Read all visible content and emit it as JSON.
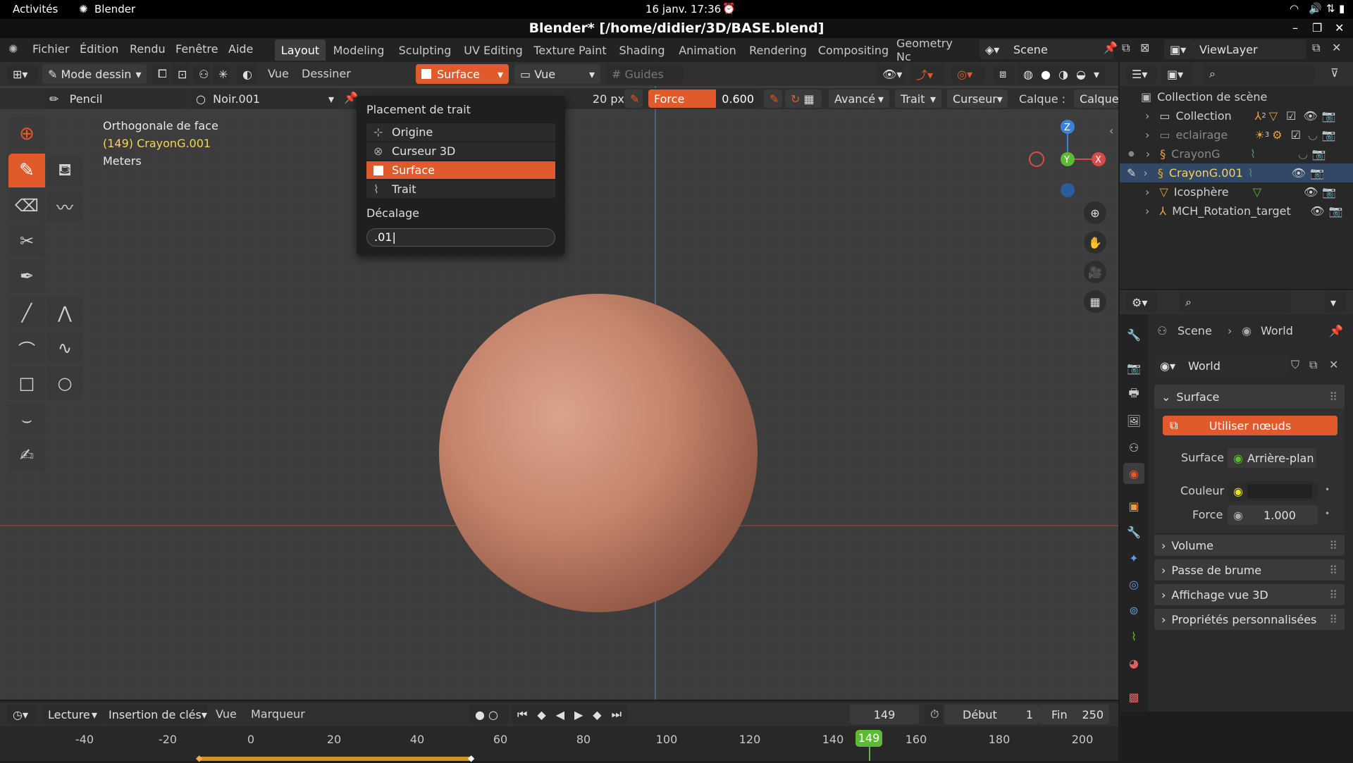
{
  "system": {
    "activities": "Activités",
    "app": "Blender",
    "clock": "16 janv.  17:36"
  },
  "window": {
    "title": "Blender* [/home/didier/3D/BASE.blend]"
  },
  "menu": [
    "Fichier",
    "Édition",
    "Rendu",
    "Fenêtre",
    "Aide"
  ],
  "workspaces": [
    "Layout",
    "Modeling",
    "Sculpting",
    "UV Editing",
    "Texture Paint",
    "Shading",
    "Animation",
    "Rendering",
    "Compositing",
    "Geometry Nc"
  ],
  "scene": "Scene",
  "viewlayer": "ViewLayer",
  "header": {
    "mode": "Mode dessin",
    "vue": "Vue",
    "dessiner": "Dessiner",
    "placement": "Surface",
    "orient": "Vue",
    "guides": "Guides"
  },
  "toolsettings": {
    "brush": "Pencil",
    "material": "Noir.001",
    "radius": "20 px",
    "force_label": "Force",
    "force_value": "0.600",
    "avance": "Avancé",
    "trait": "Trait",
    "curseur": "Curseur",
    "calque_label": "Calque :",
    "calque_value": "Calque"
  },
  "viewport": {
    "view_name": "Orthogonale de face",
    "object": "(149) CrayonG.001",
    "units": "Meters"
  },
  "popup": {
    "title": "Placement de trait",
    "items": [
      "Origine",
      "Curseur 3D",
      "Surface",
      "Trait"
    ],
    "selected": "Surface",
    "offset_label": "Décalage",
    "offset_value": ".01"
  },
  "outliner": {
    "root": "Collection de scène",
    "items": [
      "Collection",
      "eclairage",
      "CrayonG",
      "CrayonG.001",
      "Icosphère",
      "MCH_Rotation_target"
    ],
    "collection_badge": "2",
    "eclairage_badge": "3"
  },
  "properties": {
    "breadcrumb_scene": "Scene",
    "breadcrumb_world": "World",
    "world_name": "World",
    "surface_panel": "Surface",
    "use_nodes": "Utiliser nœuds",
    "surface_label": "Surface",
    "surface_value": "Arrière-plan",
    "color_label": "Couleur",
    "strength_label": "Force",
    "strength_value": "1.000",
    "panels": [
      "Volume",
      "Passe de brume",
      "Affichage vue 3D",
      "Propriétés personnalisées"
    ]
  },
  "timeline": {
    "playback": "Lecture",
    "keying": "Insertion de clés",
    "vue": "Vue",
    "marker": "Marqueur",
    "current_frame": "149",
    "start_label": "Début",
    "start_value": "1",
    "end_label": "Fin",
    "end_value": "250",
    "ticks": [
      "-40",
      "-20",
      "0",
      "20",
      "40",
      "60",
      "80",
      "100",
      "120",
      "140",
      "160",
      "180",
      "200"
    ],
    "playhead": "149"
  },
  "colors": {
    "accent": "#e05a2b",
    "active_object": "#f6d35a",
    "selection": "#e05a2b"
  }
}
